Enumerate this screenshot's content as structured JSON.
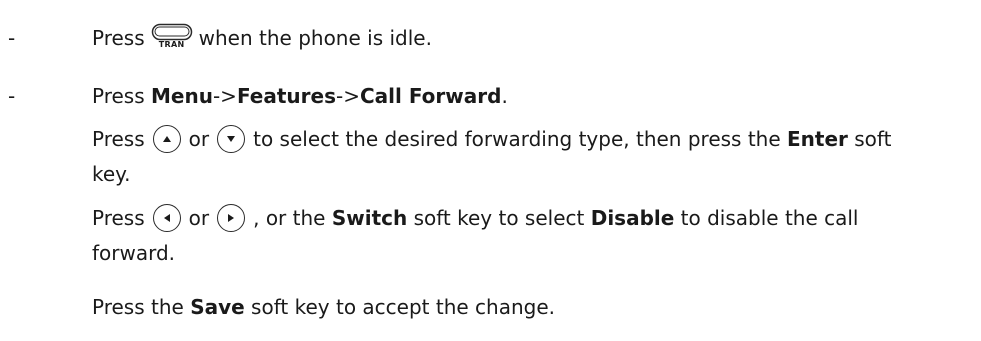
{
  "steps": [
    {
      "bullet": "-",
      "before": "Press",
      "key_caption": "TRAN",
      "after": "when the phone is idle."
    },
    {
      "bullet": "-",
      "before": "Press ",
      "menu": "Menu",
      "sep1": "->",
      "features": "Features",
      "sep2": "->",
      "call_forward": "Call Forward",
      "after": "."
    }
  ],
  "select_type": {
    "before": "Press",
    "or": "or",
    "after": "to select the desired forwarding type, then press the ",
    "enter": "Enter",
    "after2": " soft",
    "cont": "key."
  },
  "disable": {
    "before": "Press",
    "or": "or",
    "after": ", or the ",
    "switch": "Switch",
    "after2": " soft key to select ",
    "disable_label": "Disable",
    "after3": " to disable the call",
    "cont": "forward."
  },
  "save": {
    "before": "Press the ",
    "save_label": "Save",
    "after": " soft key to accept the change."
  },
  "icons": {
    "tran_key": "tran-key-icon",
    "up": "up-arrow-key-icon",
    "down": "down-arrow-key-icon",
    "left": "left-arrow-key-icon",
    "right": "right-arrow-key-icon"
  }
}
